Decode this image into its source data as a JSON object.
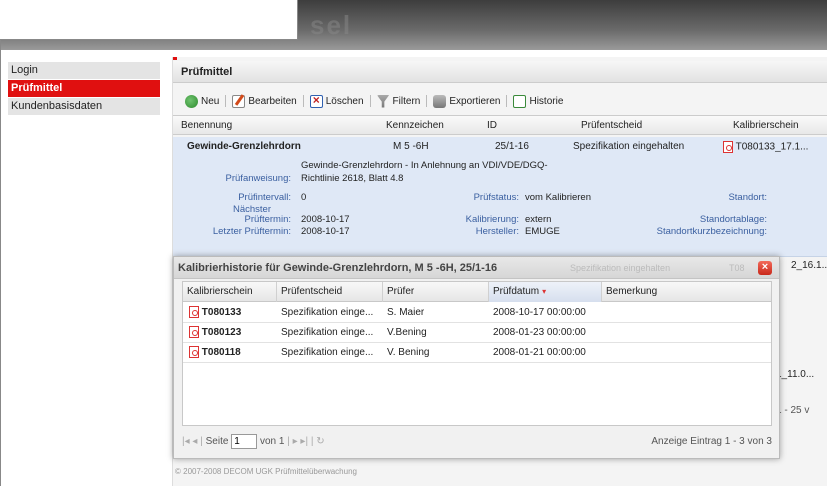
{
  "header": {
    "ghost_text": "sel"
  },
  "sidebar": {
    "items": [
      {
        "label": "Login"
      },
      {
        "label": "Prüfmittel"
      },
      {
        "label": "Kundenbasisdaten"
      }
    ]
  },
  "main": {
    "title": "Prüfmittel",
    "toolbar": {
      "new": "Neu",
      "edit": "Bearbeiten",
      "delete": "Löschen",
      "filter": "Filtern",
      "export": "Exportieren",
      "history": "Historie"
    },
    "columns": [
      "Benennung",
      "Kennzeichen",
      "ID",
      "Prüfentscheid",
      "Kalibrierschein"
    ],
    "selected_row": {
      "benennung": "Gewinde-Grenzlehrdorn",
      "kennzeichen": "M 5 -6H",
      "id": "25/1-16",
      "pruefentscheid": "Spezifikation eingehalten",
      "kalibrierschein": "T080133_17.1...",
      "details": {
        "description": "Gewinde-Grenzlehrdorn - In Anlehnung an VDI/VDE/DGQ-",
        "pa_label": "Prüfanweisung:",
        "pa_value": "Richtlinie 2618, Blatt 4.8",
        "interval_label": "Prüfintervall:",
        "interval_value": "0",
        "status_label": "Prüfstatus:",
        "status_value": "vom Kalibrieren",
        "standort_label": "Standort:",
        "next_label_1": "Nächster",
        "next_label_2": "Prüftermin:",
        "next_value": "2008-10-17",
        "kal_label": "Kalibrierung:",
        "kal_value": "extern",
        "ablage_label": "Standortablage:",
        "last_label": "Letzter Prüftermin:",
        "last_value": "2008-10-17",
        "hersteller_label": "Hersteller:",
        "hersteller_value": "EMUGE",
        "kurz_label": "Standortkurzbezeichnung:"
      }
    },
    "partial_rows": [
      "2_16.1...",
      "1_11.0...",
      "1 - 25 v"
    ],
    "footer": "© 2007-2008 DECOM UGK Prüfmittelüberwachung"
  },
  "dialog": {
    "title": "Kalibrierhistorie für Gewinde-Grenzlehrdorn, M 5 -6H, 25/1-16",
    "behind_text": "Spezifikation eingehalten",
    "behind_text_right": "T08",
    "columns": [
      "Kalibrierschein",
      "Prüfentscheid",
      "Prüfer",
      "Prüfdatum",
      "Bemerkung"
    ],
    "sort_indicator": "▾",
    "rows": [
      {
        "schein": "T080133",
        "entscheid": "Spezifikation einge...",
        "pruefer": "S. Maier",
        "datum": "2008-10-17 00:00:00",
        "bemerkung": ""
      },
      {
        "schein": "T080123",
        "entscheid": "Spezifikation einge...",
        "pruefer": "V.Bening",
        "datum": "2008-01-23 00:00:00",
        "bemerkung": ""
      },
      {
        "schein": "T080118",
        "entscheid": "Spezifikation einge...",
        "pruefer": "V. Bening",
        "datum": "2008-01-21 00:00:00",
        "bemerkung": ""
      }
    ],
    "pager": {
      "page_label": "Seite",
      "page_value": "1",
      "of_label": "von 1",
      "display": "Anzeige Eintrag 1 - 3 von 3"
    }
  }
}
